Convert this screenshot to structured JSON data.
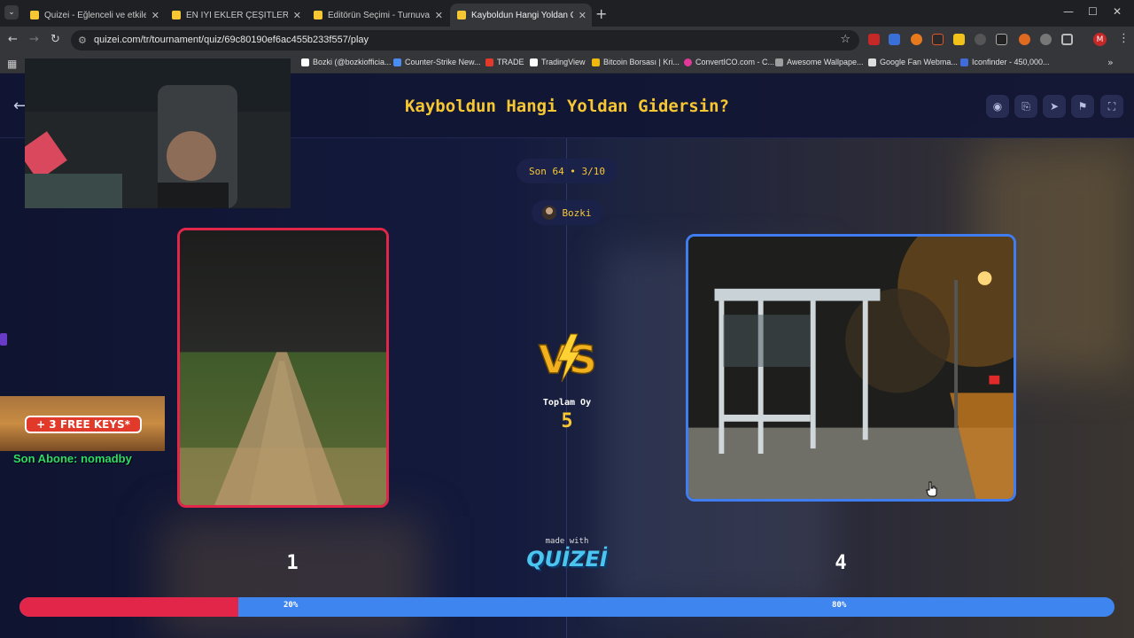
{
  "browser": {
    "tabs": [
      {
        "title": "Quizei - Eğlenceli ve etkileşimli",
        "fav_color": "#f7c733",
        "active": false
      },
      {
        "title": "EN İYİ EKLER ÇEŞİTLERİ - Tier L",
        "fav_color": "#f7c733",
        "active": false
      },
      {
        "title": "Editörün Seçimi - Turnuva - Qui",
        "fav_color": "#f7c733",
        "active": false
      },
      {
        "title": "Kayboldun Hangi Yoldan Gidersin",
        "fav_color": "#f7c733",
        "active": true
      }
    ],
    "url": "quizei.com/tr/tournament/quiz/69c80190ef6ac455b233f557/play",
    "profile_initial": "M",
    "bookmarks": [
      {
        "label": "Bozki (@bozkiofficia...",
        "color": "#ffffff"
      },
      {
        "label": "Counter-Strike New...",
        "color": "#4a8cf0"
      },
      {
        "label": "TRADE",
        "color": "#e23a2a"
      },
      {
        "label": "TradingView",
        "color": "#ffffff"
      },
      {
        "label": "Bitcoin Borsası | Kri...",
        "color": "#f0b90b"
      },
      {
        "label": "ConvertICO.com - C...",
        "color": "#e0399a"
      },
      {
        "label": "Awesome Wallpape...",
        "color": "#9e9e9e"
      },
      {
        "label": "Google Fan Webma...",
        "color": "#dddddd"
      },
      {
        "label": "Iconfinder - 450,000...",
        "color": "#3f6cd8"
      }
    ]
  },
  "quiz": {
    "title": "Kayboldun Hangi Yoldan Gidersin?",
    "round_pill": "Son 64 • 3/10",
    "user_name": "Bozki",
    "total_label": "Toplam Oy",
    "total_votes": "5",
    "left_votes": "1",
    "right_votes": "4",
    "left_share": 0.2,
    "left_percent_label": "20%",
    "right_percent_label": "80%",
    "made_with": "made with",
    "brand": "QUİZEİ",
    "left_color": "#e2264a",
    "right_color": "#3f7df0",
    "accent_color": "#f7c733"
  },
  "overlay": {
    "promo_text": "+ 3 FREE KEYS*",
    "last_sub": "Son Abone: nomadby"
  }
}
